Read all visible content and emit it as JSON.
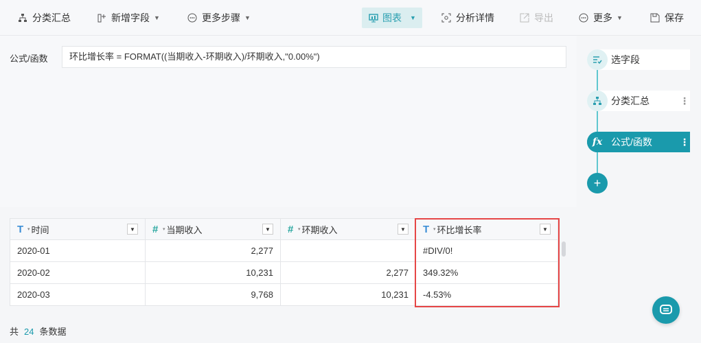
{
  "toolbar": {
    "group_summary": "分类汇总",
    "add_field": "新增字段",
    "more_steps": "更多步骤",
    "chart": "图表",
    "analysis_detail": "分析详情",
    "export": "导出",
    "more": "更多",
    "save": "保存"
  },
  "formula": {
    "label": "公式/函数",
    "expression": "环比增长率 = FORMAT((当期收入-环期收入)/环期收入,\"0.00%\")"
  },
  "steps": {
    "items": [
      {
        "label": "选字段"
      },
      {
        "label": "分类汇总"
      },
      {
        "label": "公式/函数"
      }
    ],
    "add": "+"
  },
  "table": {
    "columns": [
      {
        "label": "时间",
        "type": "T"
      },
      {
        "label": "当期收入",
        "type": "#"
      },
      {
        "label": "环期收入",
        "type": "#"
      },
      {
        "label": "环比增长率",
        "type": "T"
      }
    ],
    "rows": [
      [
        "2020-01",
        "2,277",
        "",
        "#DIV/0!"
      ],
      [
        "2020-02",
        "10,231",
        "2,277",
        "349.32%"
      ],
      [
        "2020-03",
        "9,768",
        "10,231",
        "-4.53%"
      ]
    ]
  },
  "footer": {
    "prefix": "共",
    "count": "24",
    "suffix": "条数据"
  },
  "colors": {
    "accent": "#1a9aac",
    "highlight_border": "#e64545"
  }
}
